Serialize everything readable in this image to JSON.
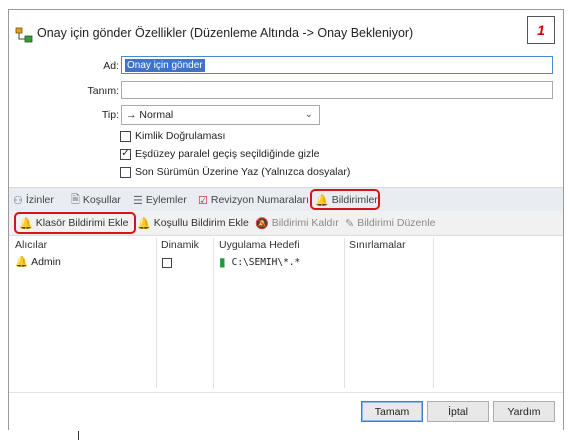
{
  "window": {
    "title": "Onay için gönder Özellikler (Düzenleme Altında -> Onay Bekleniyor)",
    "badge": "1"
  },
  "form": {
    "name_label": "Ad:",
    "name_value": "Onay için gönder",
    "description_label": "Tanım:",
    "description_value": "",
    "type_label": "Tip:",
    "type_value": "→ Normal",
    "checkboxes": [
      {
        "label": "Kimlik Doğrulaması",
        "checked": false
      },
      {
        "label": "Eşdüzey paralel geçiş seçildiğinde gizle",
        "checked": true
      },
      {
        "label": "Son Sürümün Üzerine Yaz (Yalnızca dosyalar)",
        "checked": false
      }
    ]
  },
  "tabs": [
    {
      "label": "İzinler",
      "icon": "users-icon"
    },
    {
      "label": "Koşullar",
      "icon": "document-icon"
    },
    {
      "label": "Eylemler",
      "icon": "actions-icon"
    },
    {
      "label": "Revizyon Numaraları",
      "icon": "checkbox-icon"
    },
    {
      "label": "Bildirimler",
      "icon": "bell-icon",
      "active": true
    }
  ],
  "toolbar": [
    {
      "label": "Klasör Bildirimi Ekle",
      "icon": "bell-add-icon",
      "enabled": true
    },
    {
      "label": "Koşullu Bildirim Ekle",
      "icon": "conditional-bell-icon",
      "enabled": true
    },
    {
      "label": "Bildirimi Kaldır",
      "icon": "bell-remove-icon",
      "enabled": false
    },
    {
      "label": "Bildirimi Düzenle",
      "icon": "bell-edit-icon",
      "enabled": false
    }
  ],
  "grid": {
    "columns": [
      "Alıcılar",
      "Dinamik",
      "Uygulama Hedefi",
      "Sınırlamalar"
    ],
    "rows": [
      {
        "recipient": "Admin",
        "dynamic": false,
        "target": "C:\\SEMIH\\*.*",
        "limits": ""
      }
    ]
  },
  "buttons": {
    "ok": "Tamam",
    "cancel": "İptal",
    "help": "Yardım"
  },
  "colors": {
    "highlight": "#d4141a",
    "selection": "#3e73c8",
    "badge_text": "#d40000"
  }
}
